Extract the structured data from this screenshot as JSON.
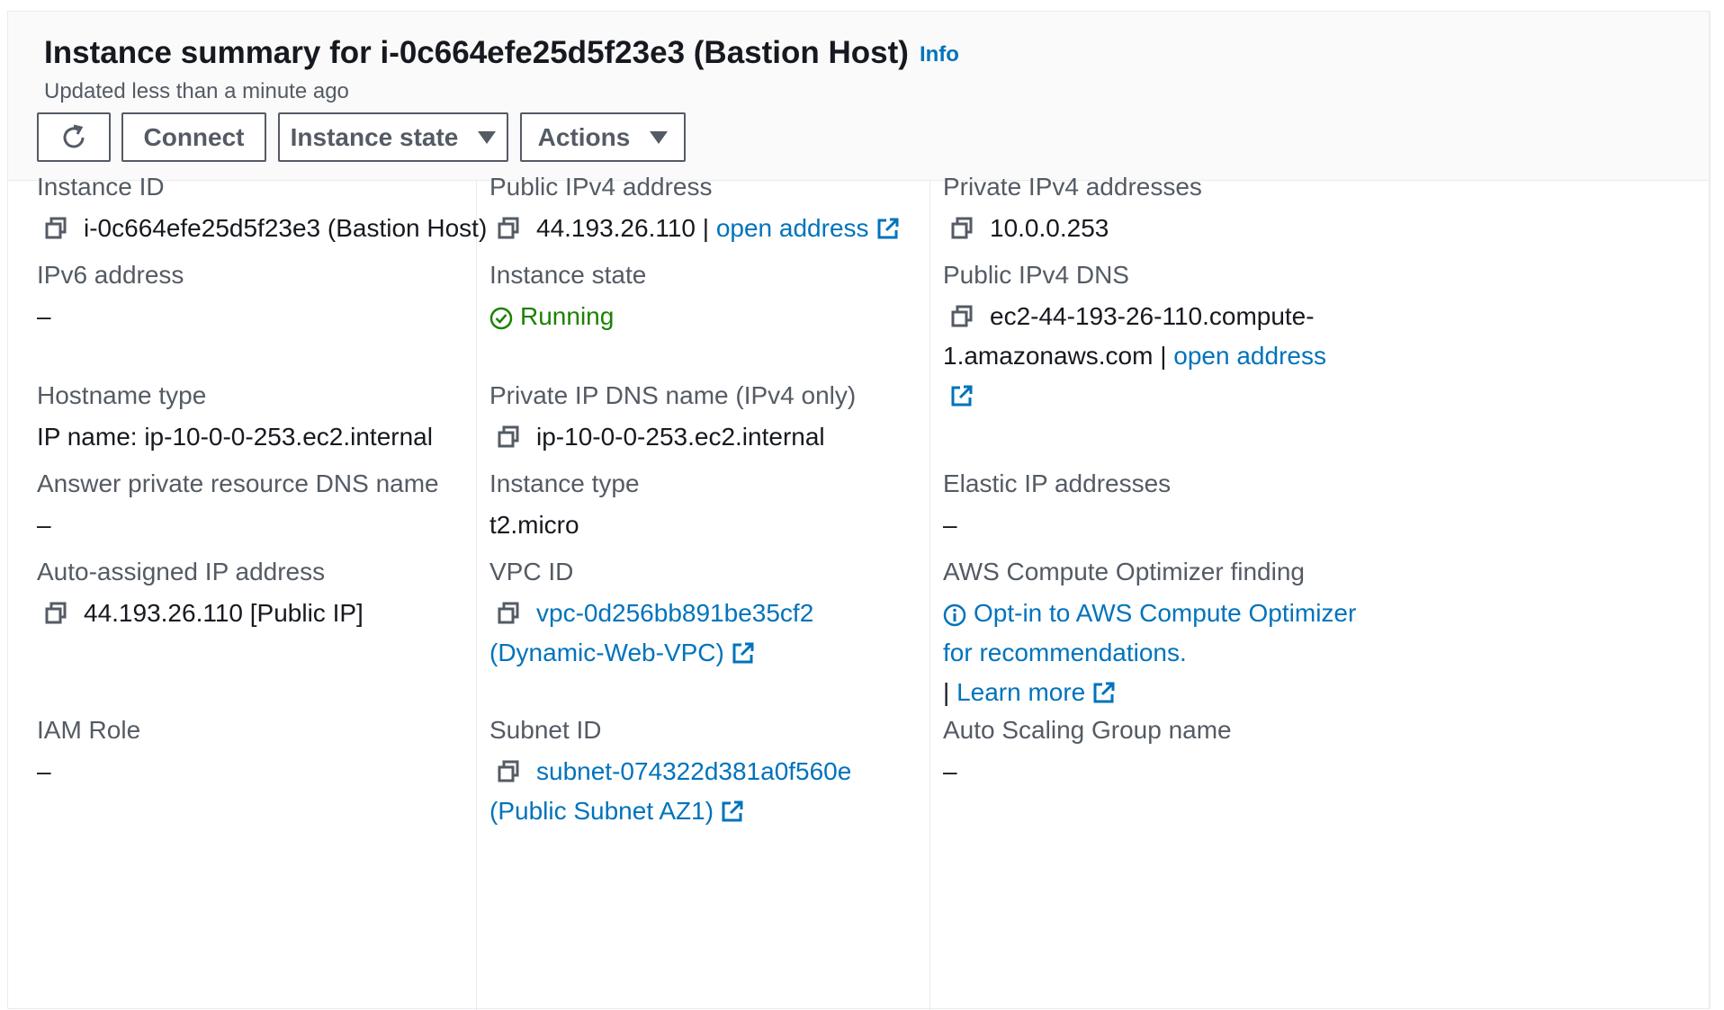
{
  "header": {
    "title": "Instance summary for i-0c664efe25d5f23e3 (Bastion Host)",
    "info": "Info",
    "updated": "Updated less than a minute ago",
    "buttons": {
      "connect": "Connect",
      "instance_state": "Instance state",
      "actions": "Actions"
    }
  },
  "fields": {
    "instance_id": {
      "label": "Instance ID",
      "value": "i-0c664efe25d5f23e3 (Bastion Host)"
    },
    "public_ipv4": {
      "label": "Public IPv4 address",
      "value": "44.193.26.110",
      "sep": "|",
      "link": "open address"
    },
    "private_ipv4": {
      "label": "Private IPv4 addresses",
      "value": "10.0.0.253"
    },
    "ipv6": {
      "label": "IPv6 address",
      "value": "–"
    },
    "instance_state": {
      "label": "Instance state",
      "value": "Running"
    },
    "public_dns": {
      "label": "Public IPv4 DNS",
      "value": "ec2-44-193-26-110.compute-1.amazonaws.com",
      "sep": "|",
      "link": "open address"
    },
    "hostname_type": {
      "label": "Hostname type",
      "value": "IP name: ip-10-0-0-253.ec2.internal"
    },
    "private_dns": {
      "label": "Private IP DNS name (IPv4 only)",
      "value": "ip-10-0-0-253.ec2.internal"
    },
    "answer_dns": {
      "label": "Answer private resource DNS name",
      "value": "–"
    },
    "instance_type": {
      "label": "Instance type",
      "value": "t2.micro"
    },
    "elastic_ip": {
      "label": "Elastic IP addresses",
      "value": "–"
    },
    "auto_ip": {
      "label": "Auto-assigned IP address",
      "value": "44.193.26.110 [Public IP]"
    },
    "vpc_id": {
      "label": "VPC ID",
      "value": "vpc-0d256bb891be35cf2 (Dynamic-Web-VPC)"
    },
    "optimizer": {
      "label": "AWS Compute Optimizer finding",
      "value": "Opt-in to AWS Compute Optimizer for recommendations.",
      "sep": "|",
      "link": "Learn more"
    },
    "iam_role": {
      "label": "IAM Role",
      "value": "–"
    },
    "subnet_id": {
      "label": "Subnet ID",
      "value": "subnet-074322d381a0f560e (Public Subnet AZ1)"
    },
    "asg_name": {
      "label": "Auto Scaling Group name",
      "value": "–"
    }
  },
  "colors": {
    "link": "#0073bb",
    "running": "#1d8102",
    "label": "#545b64",
    "text": "#16191f"
  }
}
